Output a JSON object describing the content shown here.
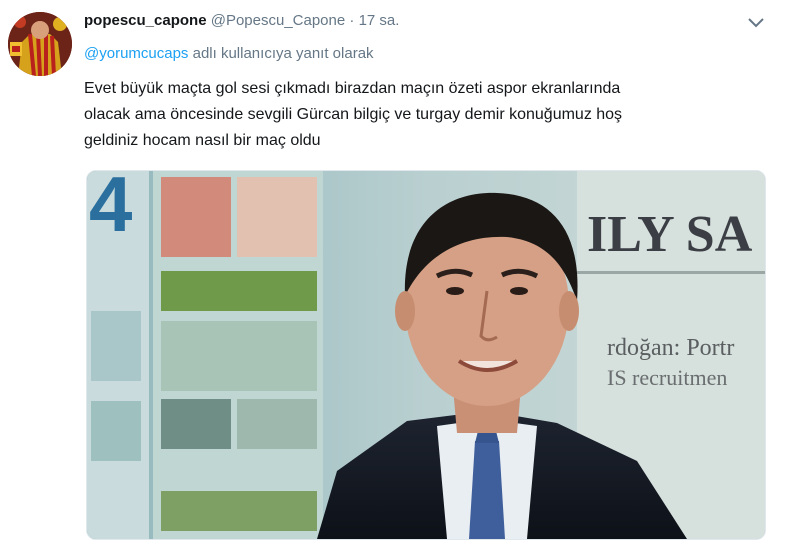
{
  "tweet": {
    "display_name": "popescu_capone",
    "handle": "@Popescu_Capone",
    "separator": "·",
    "time": "17 sa.",
    "reply_mention": "@yorumcucaps",
    "reply_suffix": "adlı kullanıcıya yanıt olarak",
    "text_lines": [
      "Evet büyük maçta gol sesi çıkmadı birazdan maçın özeti aspor ekranlarında",
      "olacak ama öncesinde sevgili Gürcan bilgiç ve turgay demir konuğumuz hoş",
      "geldiniz hocam nasıl bir maç oldu"
    ]
  },
  "media_texts": {
    "big_number": "4",
    "paper_title": "ILY SA",
    "headline_1": "rdoğan: Portr",
    "headline_2": "IS recruitmen"
  },
  "colors": {
    "link": "#1da1f2",
    "muted": "#657786",
    "text": "#14171a"
  },
  "icons": {
    "menu": "chevron-down-icon",
    "avatar": "avatar"
  }
}
